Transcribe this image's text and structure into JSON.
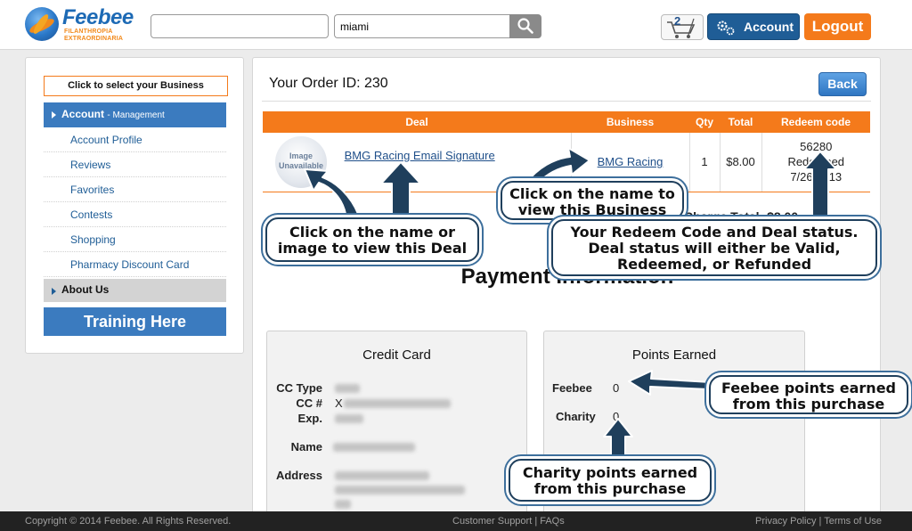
{
  "header": {
    "logo_name": "Feebee",
    "logo_sub_1": "FILANTHROPIA",
    "logo_sub_2": "EXTRAORDINARIA",
    "search_location": "miami",
    "cart_count": "2",
    "account_label": "Account",
    "logout_label": "Logout"
  },
  "sidebar": {
    "select_business": "Click to select your Business",
    "account_section": "Account",
    "account_section_sub": "- Management",
    "items": [
      {
        "label": "Account Profile"
      },
      {
        "label": "Reviews"
      },
      {
        "label": "Favorites"
      },
      {
        "label": "Contests"
      },
      {
        "label": "Shopping"
      },
      {
        "label": "Pharmacy Discount Card"
      }
    ],
    "about_section": "About Us",
    "training_label": "Training Here"
  },
  "order": {
    "title": "Your Order ID: 230",
    "back_label": "Back",
    "columns": [
      "Deal",
      "Business",
      "Qty",
      "Total",
      "Redeem code"
    ],
    "row": {
      "image_text_1": "Image",
      "image_text_2": "Unavailable",
      "deal_name": "BMG Racing Email Signature",
      "business": "BMG Racing",
      "qty": "1",
      "total": "$8.00",
      "redeem_code": "56280",
      "status": "Redeemed",
      "date": "7/26/2013"
    },
    "charge_total": "Charge Total: $8.00"
  },
  "payment": {
    "title": "Payment Information",
    "credit_card": {
      "title": "Credit Card",
      "labels": [
        "CC Type",
        "CC #",
        "Exp.",
        "Name",
        "Address"
      ],
      "cc_prefix": "X"
    },
    "points": {
      "title": "Points Earned",
      "feebee_label": "Feebee",
      "feebee_value": "0",
      "charity_label": "Charity",
      "charity_value": "0"
    }
  },
  "callouts": {
    "deal_1": "Click on the name or",
    "deal_2": "image to view this Deal",
    "business_1": "Click on the name to",
    "business_2": "view this Business",
    "redeem_1": "Your Redeem Code and Deal status.",
    "redeem_2": "Deal status will either be Valid,",
    "redeem_3": "Redeemed, or Refunded",
    "feebee_1": "Feebee points earned",
    "feebee_2": "from this purchase",
    "charity_1": "Charity points earned",
    "charity_2": "from this purchase"
  },
  "footer": {
    "copyright": "Copyright © 2014 Feebee. All Rights Reserved.",
    "support": "Customer Support | FAQs",
    "legal": "Privacy Policy | Terms of Use"
  },
  "colors": {
    "brand_blue": "#1f5d96",
    "accent_orange": "#f47a1b",
    "callout_border": "#1f3f5c"
  }
}
